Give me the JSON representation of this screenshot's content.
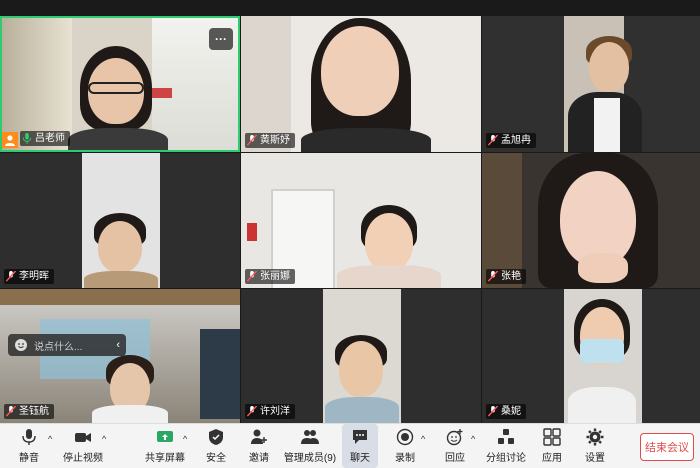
{
  "participants": [
    {
      "name": "吕老师",
      "mic": "on",
      "host": true
    },
    {
      "name": "黄斯妤",
      "mic": "muted"
    },
    {
      "name": "孟旭冉",
      "mic": "muted"
    },
    {
      "name": "李明晖",
      "mic": "muted"
    },
    {
      "name": "张丽娜",
      "mic": "muted"
    },
    {
      "name": "张艳",
      "mic": "muted"
    },
    {
      "name": "圣钰航",
      "mic": "muted"
    },
    {
      "name": "许刘洋",
      "mic": "muted"
    },
    {
      "name": "桑妮",
      "mic": "muted"
    }
  ],
  "chat_popup": {
    "placeholder": "说点什么..."
  },
  "more_button": {
    "label": "···"
  },
  "toolbar": {
    "mute": "静音",
    "stop_video": "停止视频",
    "share_screen": "共享屏幕",
    "security": "安全",
    "invite": "邀请",
    "participants": "管理成员(9)",
    "chat": "聊天",
    "record": "录制",
    "reaction": "回应",
    "breakout": "分组讨论",
    "apps": "应用",
    "settings": "设置",
    "end": "结束会议"
  },
  "colors": {
    "active_border": "#2ecc71",
    "host_badge": "#ff8c1a",
    "end": "#e14b4b",
    "muted": "#ff5a5a"
  }
}
